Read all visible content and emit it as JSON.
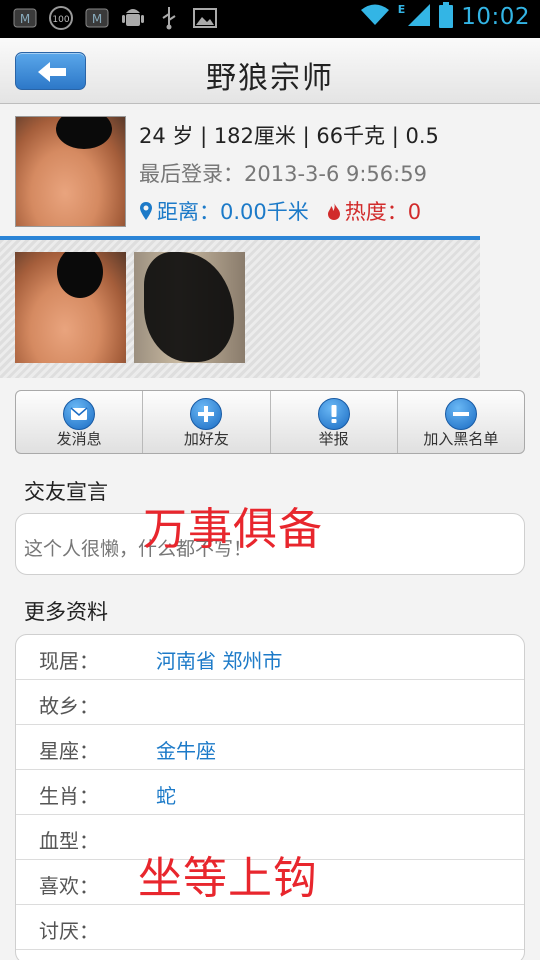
{
  "status_bar": {
    "time": "10:02",
    "network": "E"
  },
  "header": {
    "title": "野狼宗师"
  },
  "profile": {
    "stats": "24 岁 | 182厘米 | 66千克 | 0.5",
    "last_login": "最后登录：2013-3-6 9:56:59",
    "distance": "距离：0.00千米",
    "heat": "热度：0"
  },
  "actions": [
    {
      "label": "发消息",
      "icon": "mail-icon"
    },
    {
      "label": "加好友",
      "icon": "plus-icon"
    },
    {
      "label": "举报",
      "icon": "exclamation-icon"
    },
    {
      "label": "加入黑名单",
      "icon": "minus-icon"
    }
  ],
  "declaration": {
    "title": "交友宣言",
    "text": "这个人很懒，什么都不写！"
  },
  "more_info": {
    "title": "更多资料",
    "rows": [
      {
        "label": "现居：",
        "value": "河南省 郑州市"
      },
      {
        "label": "故乡：",
        "value": ""
      },
      {
        "label": "星座：",
        "value": "金牛座"
      },
      {
        "label": "生肖：",
        "value": "蛇"
      },
      {
        "label": "血型：",
        "value": ""
      },
      {
        "label": "喜欢：",
        "value": ""
      },
      {
        "label": "讨厌：",
        "value": ""
      }
    ]
  },
  "overlays": {
    "top": "万事俱备",
    "bottom": "坐等上钩"
  },
  "colors": {
    "accent_blue": "#1c7ac8",
    "heat_red": "#d12b2b",
    "overlay_red": "#e8262d"
  }
}
